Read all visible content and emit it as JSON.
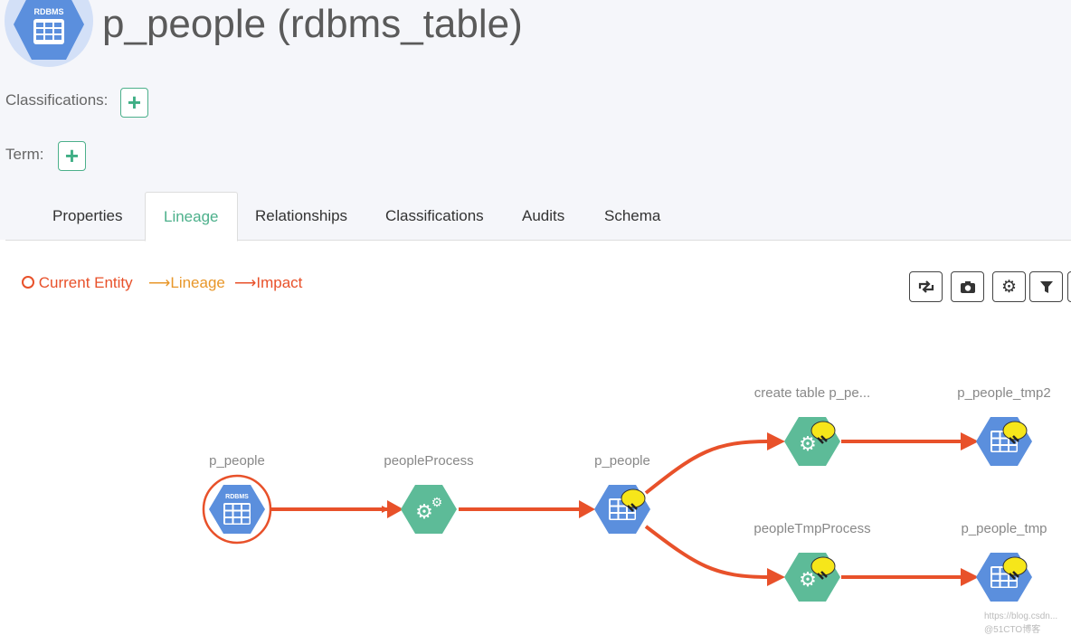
{
  "header": {
    "icon_text": "RDBMS",
    "title": "p_people (rdbms_table)"
  },
  "classifications_label": "Classifications:",
  "term_label": "Term:",
  "add_symbol": "+",
  "tabs": [
    {
      "label": "Properties"
    },
    {
      "label": "Lineage",
      "active": true
    },
    {
      "label": "Relationships"
    },
    {
      "label": "Classifications"
    },
    {
      "label": "Audits"
    },
    {
      "label": "Schema"
    }
  ],
  "legend": {
    "current": "Current Entity",
    "lineage": "Lineage",
    "impact": "Impact",
    "arrow": "⟶"
  },
  "toolbar": [
    "refresh-icon",
    "camera-icon",
    "gear-icon",
    "filter-icon"
  ],
  "colors": {
    "accent": "#4cb08b",
    "impact": "#e8512a",
    "lineage": "#e8972a",
    "table": "#5b8fdd",
    "process": "#5dbb98"
  },
  "nodes": [
    {
      "label": "p_people",
      "type": "rdbms_table",
      "current": true
    },
    {
      "label": "peopleProcess",
      "type": "process"
    },
    {
      "label": "p_people",
      "type": "hive_table"
    },
    {
      "label": "create table p_pe...",
      "type": "hive_process"
    },
    {
      "label": "p_people_tmp2",
      "type": "hive_table"
    },
    {
      "label": "peopleTmpProcess",
      "type": "hive_process"
    },
    {
      "label": "p_people_tmp",
      "type": "hive_table"
    }
  ],
  "watermark": "https://blog.csdn... @51CTO博客"
}
